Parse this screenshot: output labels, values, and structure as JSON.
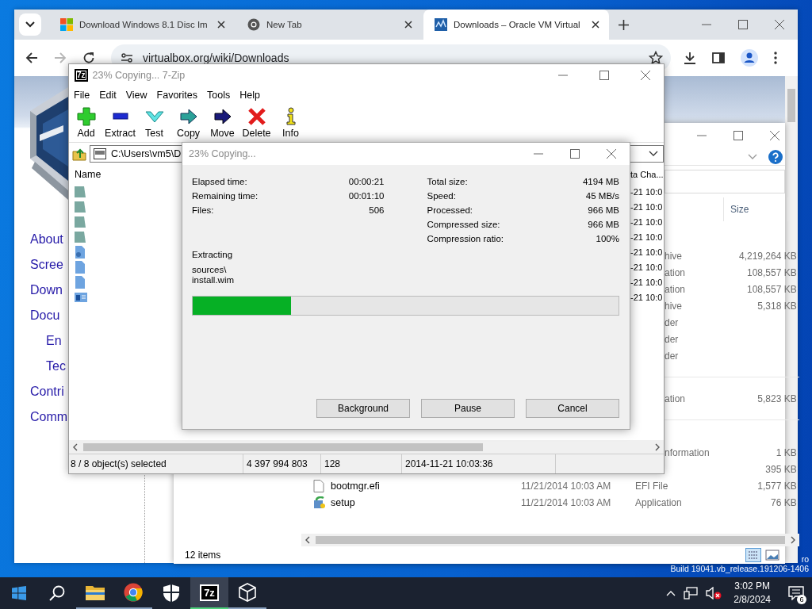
{
  "desktop": {
    "edition": "ro",
    "build": "Build 19041.vb_release.191206-1406"
  },
  "chrome": {
    "tabs": [
      {
        "title": "Download Windows 8.1 Disc Im",
        "selected": false
      },
      {
        "title": "New Tab",
        "selected": false
      },
      {
        "title": "Downloads – Oracle VM Virtual",
        "selected": true
      }
    ],
    "forward": {
      "disabled": true
    },
    "url": "virtualbox.org/wiki/Downloads",
    "page": {
      "links": [
        {
          "label": "About"
        },
        {
          "label": "Scree"
        },
        {
          "label": "Down"
        },
        {
          "label": "Docu",
          "children": [
            {
              "label": "En"
            },
            {
              "label": "Tec"
            }
          ]
        },
        {
          "label": "Contri"
        },
        {
          "label": "Comm"
        }
      ]
    }
  },
  "explorer": {
    "columns": [
      {
        "label": "Size"
      }
    ],
    "groups": [
      {
        "rows": [
          {
            "kind": "partial",
            "type": "hive",
            "size": "4,219,264 KB"
          },
          {
            "kind": "partial",
            "type": "ation",
            "size": "108,557 KB"
          },
          {
            "kind": "partial",
            "type": "ation",
            "size": "108,557 KB"
          },
          {
            "kind": "partial",
            "type": "hive",
            "size": "5,318 KB"
          },
          {
            "kind": "partial",
            "type": "der"
          },
          {
            "kind": "partial",
            "type": "der"
          },
          {
            "kind": "partial",
            "type": "der"
          }
        ]
      },
      {
        "rows": [
          {
            "kind": "partial",
            "type": "ation",
            "size": "5,823 KB"
          }
        ]
      },
      {
        "rows": [
          {
            "kind": "partial",
            "type": "nformation",
            "size": "1 KB"
          },
          {
            "kind": "partial",
            "size": "395 KB"
          },
          {
            "kind": "file",
            "name": "bootmgr.efi",
            "modified": "11/21/2014 10:03 AM",
            "type": "EFI File",
            "size": "1,577 KB"
          },
          {
            "kind": "program",
            "name": "setup",
            "modified": "11/21/2014 10:03 AM",
            "type": "Application",
            "size": "76 KB"
          }
        ]
      }
    ],
    "status": "12 items"
  },
  "sevenzip": {
    "icon_text": "7z",
    "title": "23% Copying... 7-Zip",
    "menu": [
      "File",
      "Edit",
      "View",
      "Favorites",
      "Tools",
      "Help"
    ],
    "tools": [
      "Add",
      "Extract",
      "Test",
      "Copy",
      "Move",
      "Delete",
      "Info"
    ],
    "path": "C:\\Users\\vm5\\D",
    "columns": [
      "Name",
      "ta Cha..."
    ],
    "rows": [
      {
        "kind": "folder",
        "date": "-21 10:0"
      },
      {
        "kind": "folder",
        "date": "-21 10:0"
      },
      {
        "kind": "folder",
        "date": "-21 10:0"
      },
      {
        "kind": "folder",
        "date": "-21 10:0"
      },
      {
        "kind": "setup",
        "date": "-21 10:0"
      },
      {
        "kind": "file",
        "date": "-21 10:0"
      },
      {
        "kind": "file",
        "date": "-21 10:0"
      },
      {
        "kind": "window",
        "date": "-21 10:0"
      }
    ],
    "status": [
      "8 / 8 object(s) selected",
      "4 397 994 803",
      "128",
      "2014-11-21 10:03:36"
    ]
  },
  "dialog": {
    "title": "23% Copying...",
    "left": [
      {
        "label": "Elapsed time:",
        "value": "00:00:21"
      },
      {
        "label": "Remaining time:",
        "value": "00:01:10"
      },
      {
        "label": "Files:",
        "value": "506"
      }
    ],
    "right": [
      {
        "label": "Total size:",
        "value": "4194 MB"
      },
      {
        "label": "Speed:",
        "value": "45 MB/s"
      },
      {
        "label": "Processed:",
        "value": "966 MB"
      },
      {
        "label": "Compressed size:",
        "value": "966 MB"
      },
      {
        "label": "Compression ratio:",
        "value": "100%"
      }
    ],
    "action": "Extracting",
    "file_lines": [
      "sources\\",
      "install.wim"
    ],
    "progress": {
      "level": 0.23
    },
    "buttons": [
      "Background",
      "Pause",
      "Cancel"
    ]
  },
  "taskbar": {
    "apps": [
      {
        "running": true,
        "selected": false
      },
      {
        "running": true,
        "selected": false
      },
      {
        "running": false,
        "selected": false
      },
      {
        "running": true,
        "selected": true,
        "label": "7z"
      },
      {
        "running": true,
        "selected": false
      }
    ],
    "time": "3:02 PM",
    "date": "2/8/2024",
    "notifications": "6"
  }
}
